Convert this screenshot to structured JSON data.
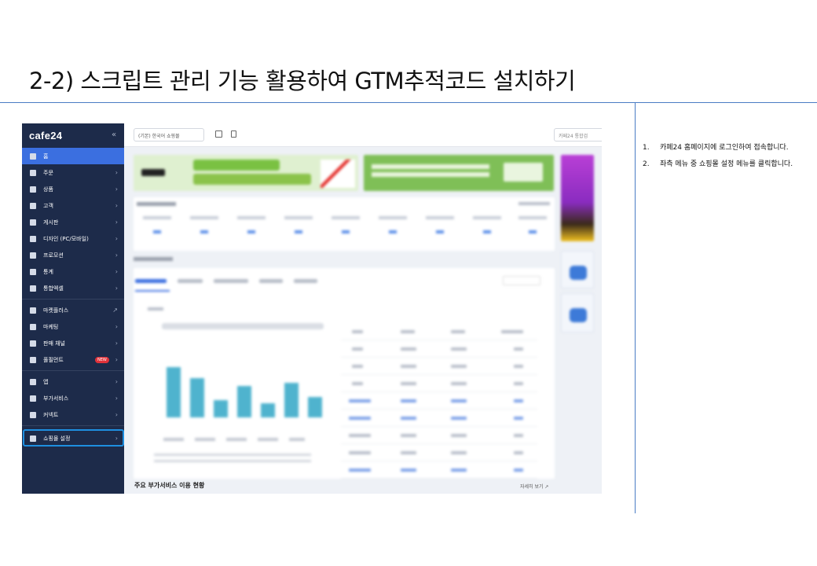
{
  "slide": {
    "title": "2-2) 스크립트 관리 기능 활용하여 GTM추적코드 설치하기"
  },
  "screenshot": {
    "logo": "cafe24",
    "collapse_icon": "«",
    "shop_select": "(기본) 한국어 쇼핑몰",
    "search_placeholder": "카페24 통합검",
    "sidebar": {
      "items": [
        {
          "label": "홈",
          "icon": "home-icon",
          "active": true
        },
        {
          "label": "주문",
          "icon": "cart-icon"
        },
        {
          "label": "상품",
          "icon": "shirt-icon"
        },
        {
          "label": "고객",
          "icon": "user-icon"
        },
        {
          "label": "게시판",
          "icon": "board-icon"
        },
        {
          "label": "디자인 (PC/모바일)",
          "icon": "palette-icon"
        },
        {
          "label": "프로모션",
          "icon": "ticket-icon"
        },
        {
          "label": "통계",
          "icon": "stats-icon"
        },
        {
          "label": "통합엑셀",
          "icon": "excel-icon"
        },
        {
          "label": "마켓플러스",
          "icon": "market-icon",
          "external": true
        },
        {
          "label": "마케팅",
          "icon": "megaphone-icon"
        },
        {
          "label": "판매 채널",
          "icon": "store-icon"
        },
        {
          "label": "풀필먼트",
          "icon": "truck-icon",
          "badge": "NEW"
        },
        {
          "label": "앱",
          "icon": "apps-icon"
        },
        {
          "label": "부가서비스",
          "icon": "plus-box-icon"
        },
        {
          "label": "커넥트",
          "icon": "connect-icon"
        },
        {
          "label": "쇼핑몰 설정",
          "icon": "gear-icon",
          "highlighted": true
        }
      ]
    },
    "bottom_section_title": "주요 부가서비스 이용 현황",
    "bottom_section_link": "자세히 보기 ↗"
  },
  "instructions": [
    {
      "num": "1.",
      "text": "카페24 홈페이지에 로그인하여 접속합니다."
    },
    {
      "num": "2.",
      "text": "좌측 메뉴 중 쇼핑몰 설정 메뉴를 클릭합니다."
    }
  ],
  "colors": {
    "sidebar_bg": "#1d2b4a",
    "active_menu": "#3b6fe0",
    "highlight_border": "#1e8fe0",
    "divider": "#4a7cc4"
  }
}
